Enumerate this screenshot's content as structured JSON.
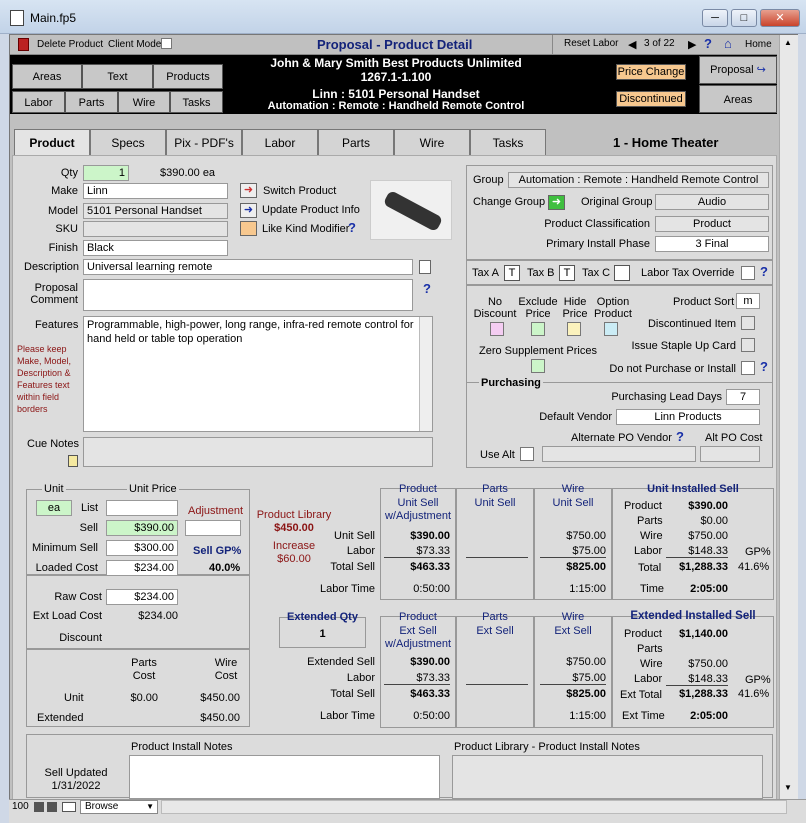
{
  "window": {
    "title": "Main.fp5",
    "min": "─",
    "max": "□",
    "close": "✕"
  },
  "toolbar": {
    "delete_product": "Delete Product",
    "client_mode": "Client Mode",
    "page_title": "Proposal - Product Detail",
    "reset_labor": "Reset Labor",
    "record_pos": "3 of 22",
    "help": "?",
    "home": "Home"
  },
  "nav": {
    "areas": "Areas",
    "text": "Text",
    "products": "Products",
    "labor": "Labor",
    "parts": "Parts",
    "wire": "Wire",
    "tasks": "Tasks"
  },
  "header": {
    "line1": "John & Mary Smith  Best Products Unlimited",
    "line2": "1267.1-1.100",
    "line3": "Linn : 5101 Personal Handset",
    "line4": "Automation : Remote : Handheld Remote Control",
    "price_change": "Price Change",
    "discontinued": "Discontinued",
    "proposal": "Proposal",
    "areas": "Areas"
  },
  "tabs": [
    "Product",
    "Specs",
    "Pix - PDF's",
    "Labor",
    "Parts",
    "Wire",
    "Tasks"
  ],
  "area_title": "1 - Home Theater",
  "product": {
    "qty_label": "Qty",
    "qty": "1",
    "price_each": "$390.00 ea",
    "make_label": "Make",
    "make": "Linn",
    "model_label": "Model",
    "model": "5101 Personal Handset",
    "sku_label": "SKU",
    "sku": "",
    "finish_label": "Finish",
    "finish": "Black",
    "description_label": "Description",
    "description": "Universal learning remote",
    "comment_label": "Proposal Comment",
    "comment": "",
    "features_label": "Features",
    "features": "Programmable, high-power, long range, infra-red remote control for hand held or table top operation",
    "keep_note": "Please keep Make, Model, Description & Features text within field borders",
    "cue_label": "Cue Notes",
    "switch_product": "Switch Product",
    "update_info": "Update Product Info",
    "like_kind": "Like Kind Modifier"
  },
  "group": {
    "group_label": "Group",
    "group": "Automation : Remote : Handheld Remote Control",
    "change_group": "Change Group",
    "original_label": "Original Group",
    "original": "Audio",
    "class_label": "Product Classification",
    "class": "Product",
    "phase_label": "Primary Install Phase",
    "phase": "3 Final"
  },
  "tax": {
    "a": "Tax A",
    "a_val": "T",
    "b": "Tax B",
    "b_val": "T",
    "c": "Tax C",
    "c_val": "",
    "override": "Labor Tax Override"
  },
  "flags": {
    "no_discount": "No Discount",
    "exclude_price": "Exclude Price",
    "hide_price": "Hide Price",
    "option_product": "Option Product",
    "product_sort": "Product Sort",
    "sort_val": "m",
    "discontinued_item": "Discontinued Item",
    "staple": "Issue Staple Up Card",
    "zero_supp": "Zero Supplement Prices",
    "no_purchase": "Do not Purchase or Install"
  },
  "purchasing": {
    "title": "Purchasing",
    "lead_label": "Purchasing Lead Days",
    "lead": "7",
    "vendor_label": "Default Vendor",
    "vendor": "Linn Products",
    "alt_vendor_label": "Alternate PO Vendor",
    "alt_cost_label": "Alt PO Cost",
    "use_alt": "Use Alt"
  },
  "pricing": {
    "unit_label": "Unit",
    "unit": "ea",
    "unit_price_label": "Unit Price",
    "list_label": "List",
    "list": "",
    "adjustment_label": "Adjustment",
    "adjustment": "",
    "sell_label": "Sell",
    "sell": "$390.00",
    "min_label": "Minimum Sell",
    "min": "$300.00",
    "gp_label": "Sell GP%",
    "gp": "40.0%",
    "loaded_label": "Loaded Cost",
    "loaded": "$234.00",
    "raw_label": "Raw Cost",
    "raw": "$234.00",
    "ext_load_label": "Ext Load Cost",
    "ext_load": "$234.00",
    "discount_label": "Discount",
    "parts_cost_label": "Parts Cost",
    "wire_cost_label": "Wire Cost",
    "unit_row": "Unit",
    "ext_row": "Extended",
    "parts_unit": "$0.00",
    "wire_unit": "$450.00",
    "parts_ext": "",
    "wire_ext": "$450.00"
  },
  "library": {
    "label": "Product Library",
    "price": "$450.00",
    "increase_label": "Increase",
    "increase": "$60.00"
  },
  "unit_table": {
    "product_h": "Product",
    "product_sub": "Unit Sell w/Adjustment",
    "parts_h": "Parts",
    "parts_sub": "Unit Sell",
    "wire_h": "Wire",
    "wire_sub": "Unit Sell",
    "installed_h": "Unit Installed Sell",
    "row_labels": [
      "Unit Sell",
      "Labor",
      "Total Sell",
      "Labor Time"
    ],
    "product": [
      "$390.00",
      "$73.33",
      "$463.33",
      "0:50:00"
    ],
    "wire": [
      "$750.00",
      "$75.00",
      "$825.00",
      "1:15:00"
    ],
    "inst_labels": [
      "Product",
      "Parts",
      "Wire",
      "Labor",
      "Total",
      "Time"
    ],
    "inst_values": [
      "$390.00",
      "$0.00",
      "$750.00",
      "$148.33",
      "$1,288.33",
      "2:05:00"
    ],
    "gp_label": "GP%",
    "gp": "41.6%"
  },
  "ext_table": {
    "qty_label": "Extended Qty",
    "qty": "1",
    "product_h": "Product",
    "product_sub": "Ext Sell w/Adjustment",
    "parts_h": "Parts",
    "parts_sub": "Ext Sell",
    "wire_h": "Wire",
    "wire_sub": "Ext Sell",
    "installed_h": "Extended Installed Sell",
    "row_labels": [
      "Extended Sell",
      "Labor",
      "Total Sell",
      "Labor Time"
    ],
    "product": [
      "$390.00",
      "$73.33",
      "$463.33",
      "0:50:00"
    ],
    "wire": [
      "$750.00",
      "$75.00",
      "$825.00",
      "1:15:00"
    ],
    "inst_labels": [
      "Product",
      "Parts",
      "Wire",
      "Labor",
      "Ext Total",
      "Ext Time"
    ],
    "inst_values": [
      "$1,140.00",
      "",
      "$750.00",
      "$148.33",
      "$1,288.33",
      "2:05:00"
    ],
    "gp_label": "GP%",
    "gp": "41.6%"
  },
  "notes": {
    "install_label": "Product Install Notes",
    "library_label": "Product Library - Product Install Notes",
    "sell_updated_label": "Sell Updated",
    "sell_updated": "1/31/2022"
  },
  "status": {
    "zoom": "100",
    "mode": "Browse"
  }
}
